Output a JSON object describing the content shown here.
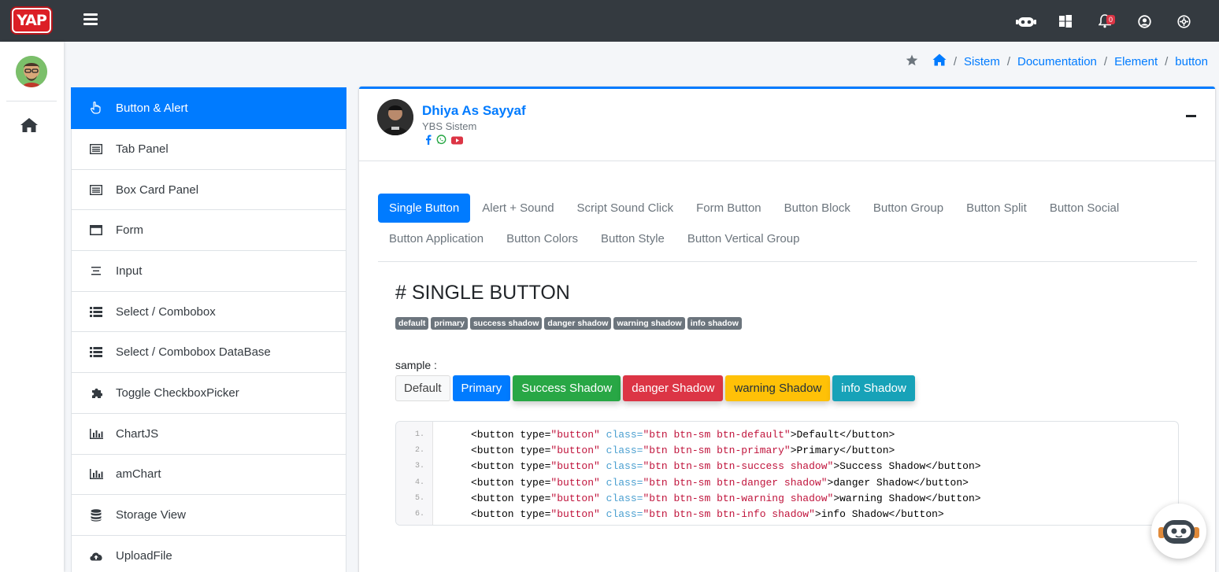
{
  "app": {
    "logo_text": "YAP"
  },
  "topbar": {
    "notification_count": "0",
    "icons": [
      "assistant-icon",
      "windows-icon",
      "bell-icon",
      "user-circle-icon",
      "settings-gear-icon"
    ]
  },
  "breadcrumb": {
    "items": [
      "Sistem",
      "Documentation",
      "Element",
      "button"
    ]
  },
  "menu": {
    "items": [
      {
        "label": "Button & Alert",
        "icon": "pointer-hand-icon",
        "active": true
      },
      {
        "label": "Tab Panel",
        "icon": "list-alt-icon"
      },
      {
        "label": "Box Card Panel",
        "icon": "list-alt-icon"
      },
      {
        "label": "Form",
        "icon": "window-icon"
      },
      {
        "label": "Input",
        "icon": "align-center-icon"
      },
      {
        "label": "Select / Combobox",
        "icon": "list-icon"
      },
      {
        "label": "Select / Combobox DataBase",
        "icon": "list-icon"
      },
      {
        "label": "Toggle CheckboxPicker",
        "icon": "puzzle-icon"
      },
      {
        "label": "ChartJS",
        "icon": "bar-chart-icon"
      },
      {
        "label": "amChart",
        "icon": "bar-chart-icon"
      },
      {
        "label": "Storage View",
        "icon": "database-icon"
      },
      {
        "label": "UploadFile",
        "icon": "cloud-upload-icon"
      }
    ]
  },
  "profile": {
    "name": "Dhiya As Sayyaf",
    "subtitle": "YBS Sistem"
  },
  "tabs": [
    "Single Button",
    "Alert + Sound",
    "Script Sound Click",
    "Form Button",
    "Button Block",
    "Button Group",
    "Button Split",
    "Button Social",
    "Button Application",
    "Button Colors",
    "Button Style",
    "Button Vertical Group"
  ],
  "section": {
    "title": "# SINGLE BUTTON",
    "badges": [
      "default",
      "primary",
      "success shadow",
      "danger shadow",
      "warning shadow",
      "info shadow"
    ],
    "sample_label": "sample :",
    "buttons": {
      "default": "Default",
      "primary": "Primary",
      "success": "Success Shadow",
      "danger": "danger Shadow",
      "warning": "warning Shadow",
      "info": "info Shadow"
    }
  },
  "code": {
    "line_numbers": [
      "1.",
      "2.",
      "3.",
      "4.",
      "5.",
      "6."
    ],
    "lines": [
      {
        "cls": "btn btn-sm btn-default",
        "text": "Default"
      },
      {
        "cls": "btn btn-sm btn-primary",
        "text": "Primary"
      },
      {
        "cls": "btn btn-sm btn-success shadow",
        "text": "Success Shadow"
      },
      {
        "cls": "btn btn-sm btn-danger shadow",
        "text": "danger Shadow"
      },
      {
        "cls": "btn btn-sm btn-warning shadow",
        "text": "warning Shadow"
      },
      {
        "cls": "btn btn-sm btn-info shadow",
        "text": "info Shadow"
      }
    ],
    "tag_open": "<button",
    "attr_type": "type",
    "attr_type_value": "\"button\"",
    "attr_class": "class",
    "tag_close": "</button>"
  },
  "colors": {
    "accent": "#007bff",
    "topbar": "#343a40",
    "success": "#28a745",
    "danger": "#dc3545",
    "warning": "#ffc107",
    "info": "#17a2b8"
  }
}
